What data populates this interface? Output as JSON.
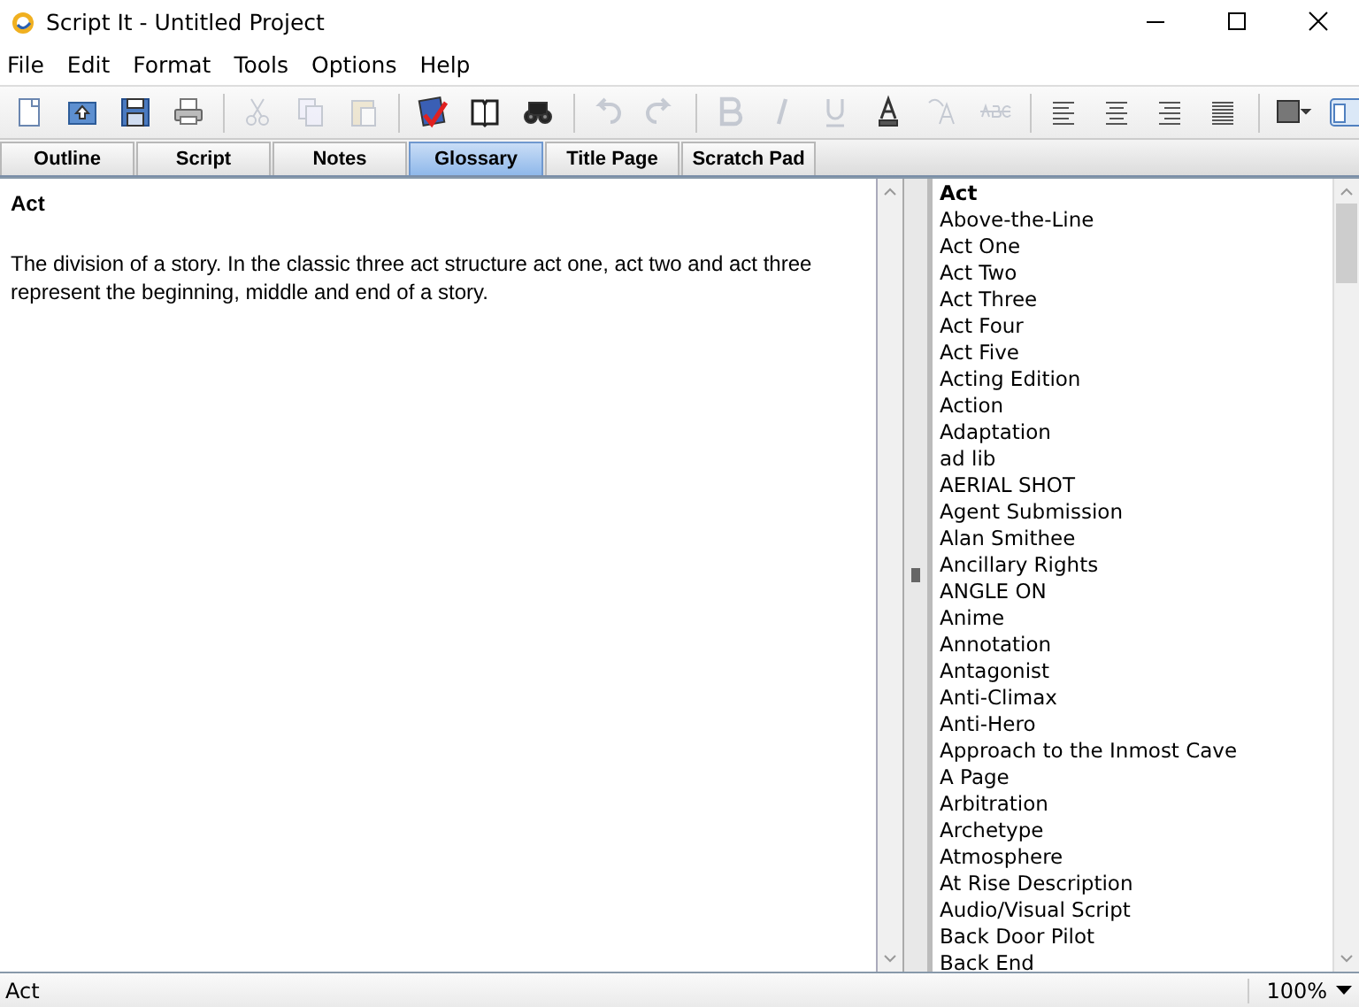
{
  "window": {
    "title": "Script It - Untitled Project"
  },
  "menu": [
    "File",
    "Edit",
    "Format",
    "Tools",
    "Options",
    "Help"
  ],
  "toolbar": [
    {
      "kind": "new",
      "disabled": false
    },
    {
      "kind": "open",
      "disabled": false
    },
    {
      "kind": "save",
      "disabled": false
    },
    {
      "kind": "print",
      "disabled": false
    },
    {
      "kind": "sep"
    },
    {
      "kind": "cut",
      "disabled": true
    },
    {
      "kind": "copy",
      "disabled": true
    },
    {
      "kind": "paste",
      "disabled": true
    },
    {
      "kind": "sep"
    },
    {
      "kind": "spell",
      "disabled": false
    },
    {
      "kind": "book",
      "disabled": false
    },
    {
      "kind": "find",
      "disabled": false
    },
    {
      "kind": "sep"
    },
    {
      "kind": "undo",
      "disabled": true
    },
    {
      "kind": "redo",
      "disabled": true
    },
    {
      "kind": "sep"
    },
    {
      "kind": "bold",
      "disabled": true
    },
    {
      "kind": "italic",
      "disabled": true
    },
    {
      "kind": "underline",
      "disabled": true
    },
    {
      "kind": "fontcolor",
      "disabled": false
    },
    {
      "kind": "clearformat",
      "disabled": true
    },
    {
      "kind": "strike",
      "disabled": true
    },
    {
      "kind": "sep"
    },
    {
      "kind": "alignleft",
      "disabled": false
    },
    {
      "kind": "aligncenter",
      "disabled": false
    },
    {
      "kind": "alignright",
      "disabled": false
    },
    {
      "kind": "justify",
      "disabled": false
    },
    {
      "kind": "sep"
    },
    {
      "kind": "fill",
      "disabled": false
    },
    {
      "kind": "layout",
      "disabled": false
    }
  ],
  "tabs": [
    {
      "label": "Outline",
      "selected": false
    },
    {
      "label": "Script",
      "selected": false
    },
    {
      "label": "Notes",
      "selected": false
    },
    {
      "label": "Glossary",
      "selected": true
    },
    {
      "label": "Title Page",
      "selected": false
    },
    {
      "label": "Scratch Pad",
      "selected": false
    }
  ],
  "definition": {
    "term": "Act",
    "text": "The division of a story.  In the classic three act structure act one, act two and act three represent the beginning, middle and end of a story."
  },
  "glossary": [
    {
      "label": "Act",
      "selected": true
    },
    {
      "label": "Above-the-Line",
      "selected": false
    },
    {
      "label": "Act One",
      "selected": false
    },
    {
      "label": "Act Two",
      "selected": false
    },
    {
      "label": "Act Three",
      "selected": false
    },
    {
      "label": "Act Four",
      "selected": false
    },
    {
      "label": "Act Five",
      "selected": false
    },
    {
      "label": "Acting Edition",
      "selected": false
    },
    {
      "label": "Action",
      "selected": false
    },
    {
      "label": "Adaptation",
      "selected": false
    },
    {
      "label": "ad lib",
      "selected": false
    },
    {
      "label": "AERIAL SHOT",
      "selected": false
    },
    {
      "label": "Agent Submission",
      "selected": false
    },
    {
      "label": "Alan Smithee",
      "selected": false
    },
    {
      "label": "Ancillary Rights",
      "selected": false
    },
    {
      "label": "ANGLE ON",
      "selected": false
    },
    {
      "label": "Anime",
      "selected": false
    },
    {
      "label": "Annotation",
      "selected": false
    },
    {
      "label": "Antagonist",
      "selected": false
    },
    {
      "label": "Anti-Climax",
      "selected": false
    },
    {
      "label": "Anti-Hero",
      "selected": false
    },
    {
      "label": "Approach to the Inmost Cave",
      "selected": false
    },
    {
      "label": "A Page",
      "selected": false
    },
    {
      "label": "Arbitration",
      "selected": false
    },
    {
      "label": "Archetype",
      "selected": false
    },
    {
      "label": "Atmosphere",
      "selected": false
    },
    {
      "label": "At Rise Description",
      "selected": false
    },
    {
      "label": "Audio/Visual Script",
      "selected": false
    },
    {
      "label": "Back Door Pilot",
      "selected": false
    },
    {
      "label": "Back End",
      "selected": false
    }
  ],
  "status_bar": {
    "text": "Act",
    "zoom": "100%"
  }
}
